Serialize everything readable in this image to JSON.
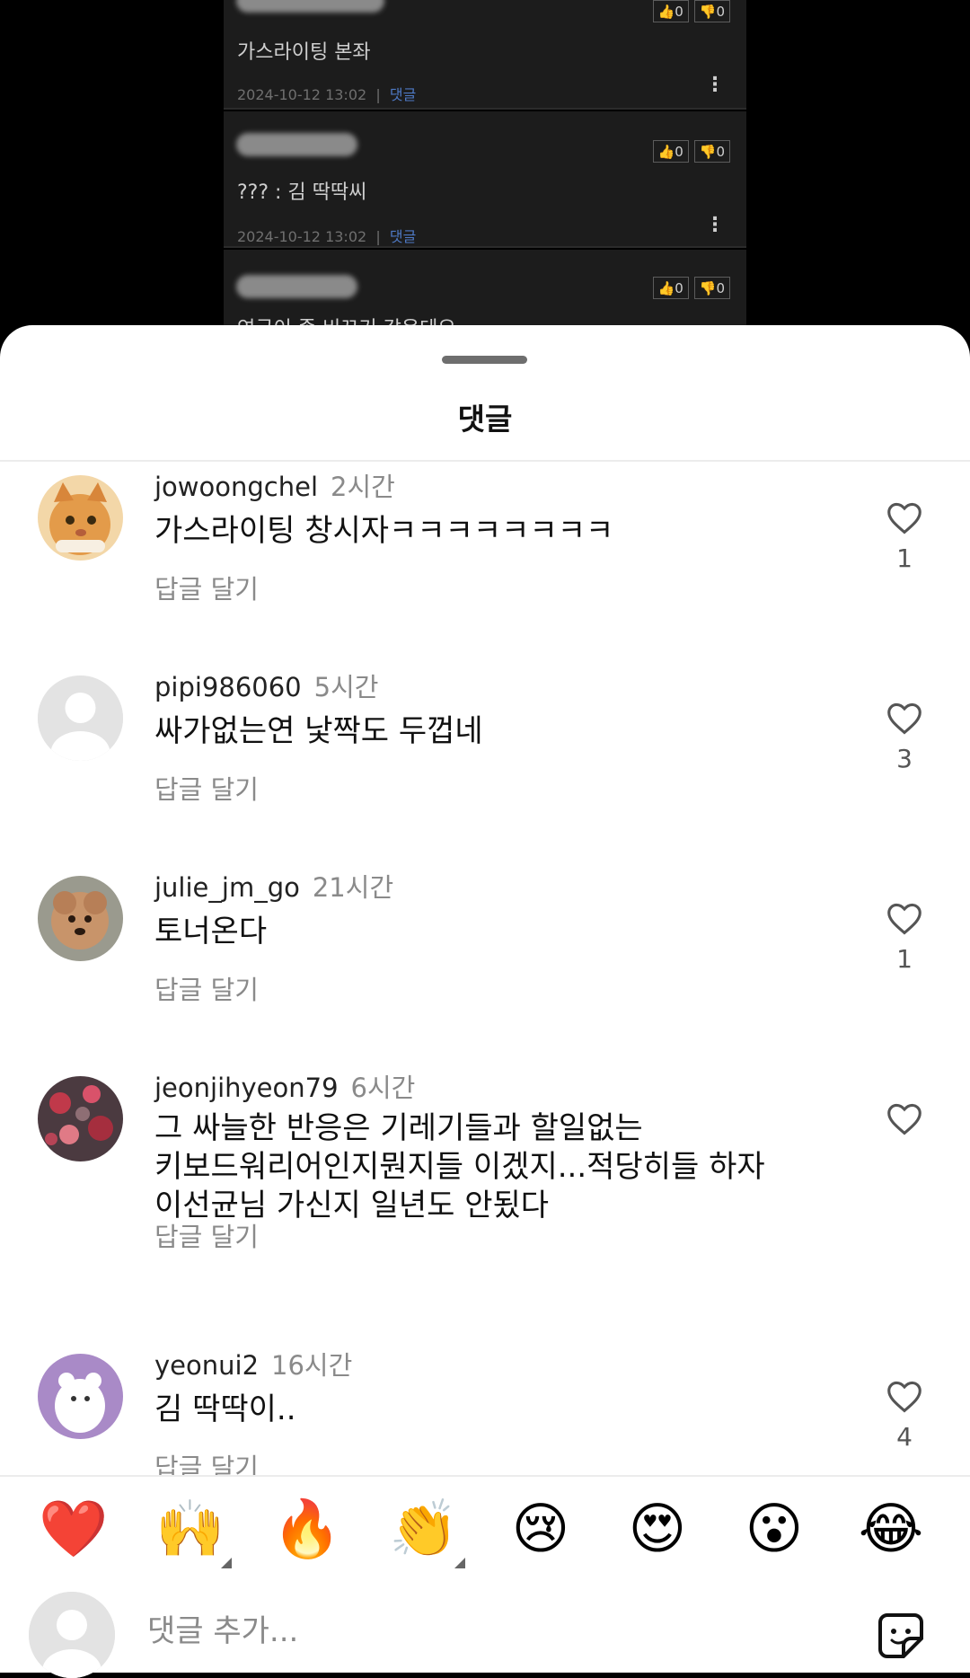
{
  "background_posts": [
    {
      "text": "가스라이팅 본좌",
      "date": "2024-10-12 13:02",
      "reply_label": "댓글",
      "likes": "0",
      "dislikes": "0"
    },
    {
      "text": "??? : 김 딱딱씨",
      "date": "2024-10-12 13:02",
      "reply_label": "댓글",
      "likes": "0",
      "dislikes": "0"
    },
    {
      "text": "연금이 좀 비꼬기 같은데요",
      "date": "",
      "reply_label": "",
      "likes": "0",
      "dislikes": "0"
    }
  ],
  "sheet": {
    "title": "댓글"
  },
  "comments": [
    {
      "username": "jowoongchel",
      "time": "2시간",
      "text": "가스라이팅 창시자ㅋㅋㅋㅋㅋㅋㅋㅋ",
      "reply_label": "답글 달기",
      "likes": "1"
    },
    {
      "username": "pipi986060",
      "time": "5시간",
      "text": "싸가없는연 낯짝도 두껍네",
      "reply_label": "답글 달기",
      "likes": "3"
    },
    {
      "username": "julie_jm_go",
      "time": "21시간",
      "text": "토너온다",
      "reply_label": "답글 달기",
      "likes": "1"
    },
    {
      "username": "jeonjihyeon79",
      "time": "6시간",
      "text": "그 싸늘한 반응은 기레기들과 할일없는\n키보드워리어인지뭔지들 이겠지...적당히들 하자\n이선균님 가신지 일년도 안됬다",
      "reply_label": "답글 달기",
      "likes": ""
    },
    {
      "username": "yeonui2",
      "time": "16시간",
      "text": "김 딱딱이..",
      "reply_label": "답글 달기",
      "likes": "4"
    }
  ],
  "emoji_bar": [
    {
      "emoji": "❤️",
      "name": "heart-emoji"
    },
    {
      "emoji": "🙌",
      "name": "raising-hands-emoji"
    },
    {
      "emoji": "🔥",
      "name": "fire-emoji"
    },
    {
      "emoji": "👏",
      "name": "clapping-emoji"
    },
    {
      "emoji": "😢",
      "name": "crying-emoji"
    },
    {
      "emoji": "😍",
      "name": "heart-eyes-emoji"
    },
    {
      "emoji": "😮",
      "name": "surprised-emoji"
    },
    {
      "emoji": "😂",
      "name": "tears-of-joy-emoji"
    }
  ],
  "composer": {
    "placeholder": "댓글 추가..."
  },
  "colors": {
    "accent_link": "#4e79c4",
    "muted": "#8a8a8a"
  }
}
